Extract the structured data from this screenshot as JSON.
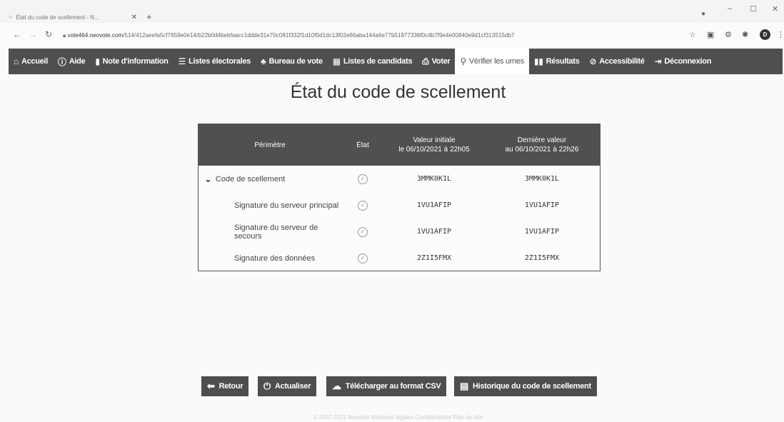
{
  "browser": {
    "tab_title": "État du code de scellement - N...",
    "url_host": "vote464.neovote.com",
    "url_path": "/514/412aeefa5cf7659e0e14/b22b0d4bebfaacc1ddde31e70c081f332f1d10f0d1dc13f02e66aba144a6e77b51977336f0c4b7f9e4e00840e9d1cf313515db7",
    "profile_letter": "D"
  },
  "nav": {
    "items": [
      {
        "label": "Accueil",
        "icon": "home-icon"
      },
      {
        "label": "Aide",
        "icon": "help-icon"
      },
      {
        "label": "Note d'information",
        "icon": "document-icon"
      },
      {
        "label": "Listes électorales",
        "icon": "list-icon"
      },
      {
        "label": "Bureau de vote",
        "icon": "users-icon"
      },
      {
        "label": "Listes de candidats",
        "icon": "ballot-icon"
      },
      {
        "label": "Voter",
        "icon": "vote-icon"
      },
      {
        "label": "Vérifier les urnes",
        "icon": "verify-icon",
        "active": true
      },
      {
        "label": "Résultats",
        "icon": "chart-icon"
      },
      {
        "label": "Accessibilité",
        "icon": "eye-slash-icon"
      },
      {
        "label": "Déconnexion",
        "icon": "logout-icon"
      }
    ]
  },
  "page": {
    "title": "État du code de scellement"
  },
  "table": {
    "headers": {
      "perimetre": "Périmètre",
      "etat": "État",
      "initial_line1": "Valeur initiale",
      "initial_line2": "le 06/10/2021 à 22h05",
      "last_line1": "Dernière valeur",
      "last_line2": "au 06/10/2021 à 22h26"
    },
    "rows": [
      {
        "perimetre": "Code de scellement",
        "initial": "3MMK0K1L",
        "last": "3MMK0K1L"
      },
      {
        "perimetre": "Signature du serveur principal",
        "initial": "1VU1AFIP",
        "last": "1VU1AFIP"
      },
      {
        "perimetre": "Signature du serveur de secours",
        "initial": "1VU1AFIP",
        "last": "1VU1AFIP"
      },
      {
        "perimetre": "Signature des données",
        "initial": "2Z1I5FMX",
        "last": "2Z1I5FMX"
      }
    ]
  },
  "buttons": {
    "back": "Retour",
    "refresh": "Actualiser",
    "download": "Télécharger au format CSV",
    "history": "Historique du code de scellement"
  },
  "footer": {
    "text": "© 2007-2021 Neovote   Mentions légales   Confidentialité   Plan du site"
  }
}
